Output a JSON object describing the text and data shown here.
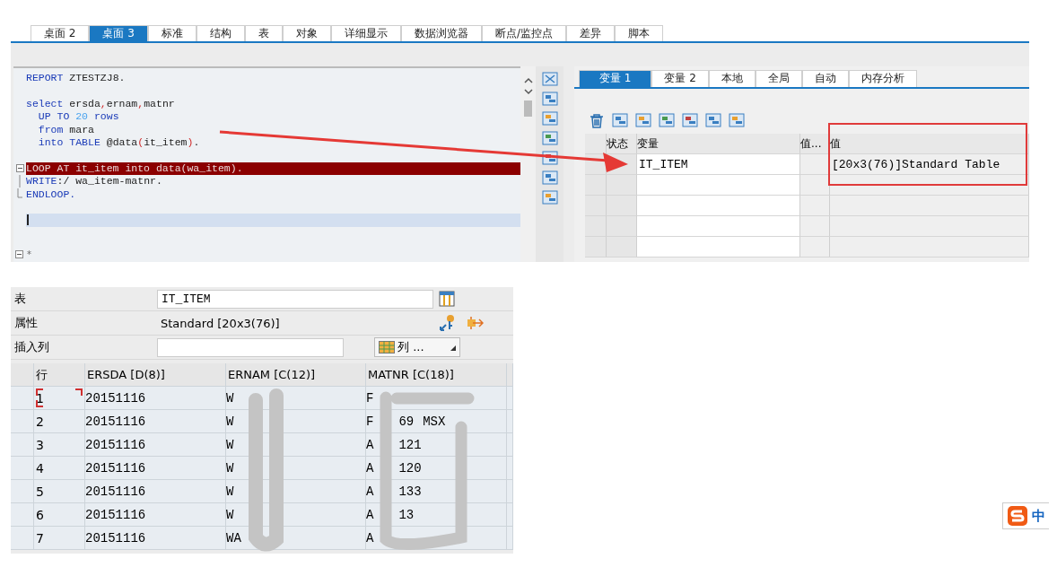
{
  "top_tabs": [
    {
      "label": "桌面 2",
      "selected": false
    },
    {
      "label": "桌面 3",
      "selected": true
    },
    {
      "label": "标准",
      "selected": false
    },
    {
      "label": "结构",
      "selected": false
    },
    {
      "label": "表",
      "selected": false
    },
    {
      "label": "对象",
      "selected": false
    },
    {
      "label": "详细显示",
      "selected": false
    },
    {
      "label": "数据浏览器",
      "selected": false
    },
    {
      "label": "断点/监控点",
      "selected": false
    },
    {
      "label": "差异",
      "selected": false
    },
    {
      "label": "脚本",
      "selected": false
    }
  ],
  "editor": {
    "lines": [
      {
        "kind": "code",
        "current": false,
        "cursor": false,
        "tokens": [
          {
            "t": "REPORT",
            "kind": "kw"
          },
          {
            "t": " ZTESTZJ8.",
            "kind": "plain"
          }
        ]
      },
      {
        "kind": "blank",
        "current": false,
        "cursor": false
      },
      {
        "kind": "code",
        "current": false,
        "cursor": false,
        "tokens": [
          {
            "t": "select",
            "kind": "kw"
          },
          {
            "t": " ersda",
            "kind": "plain"
          },
          {
            "t": ",",
            "kind": "punct"
          },
          {
            "t": "ernam",
            "kind": "plain"
          },
          {
            "t": ",",
            "kind": "punct"
          },
          {
            "t": "matnr",
            "kind": "plain"
          }
        ]
      },
      {
        "kind": "code",
        "current": false,
        "cursor": false,
        "tokens": [
          {
            "t": "  UP TO ",
            "kind": "kw"
          },
          {
            "t": "20",
            "kind": "num"
          },
          {
            "t": " rows",
            "kind": "kw"
          }
        ]
      },
      {
        "kind": "code",
        "current": false,
        "cursor": false,
        "tokens": [
          {
            "t": "  from",
            "kind": "kw"
          },
          {
            "t": " mara",
            "kind": "plain"
          }
        ]
      },
      {
        "kind": "code",
        "current": false,
        "cursor": false,
        "tokens": [
          {
            "t": "  into TABLE",
            "kind": "kw"
          },
          {
            "t": " @data",
            "kind": "plain"
          },
          {
            "t": "(",
            "kind": "punct"
          },
          {
            "t": "it_item",
            "kind": "plain"
          },
          {
            "t": ")",
            "kind": "punct"
          },
          {
            "t": ".",
            "kind": "plain"
          }
        ]
      },
      {
        "kind": "blank",
        "current": false,
        "cursor": false
      },
      {
        "kind": "fold_start",
        "current": true,
        "cursor": false,
        "tokens": [
          {
            "t": "LOOP AT it_item into data(wa_item).",
            "kind": "plain"
          }
        ]
      },
      {
        "kind": "fold_inner",
        "current": false,
        "cursor": false,
        "tokens": [
          {
            "t": "WRITE",
            "kind": "kw"
          },
          {
            "t": ":/ wa_item-matnr.",
            "kind": "plain"
          }
        ]
      },
      {
        "kind": "fold_end",
        "current": false,
        "cursor": false,
        "tokens": [
          {
            "t": "ENDLOOP.",
            "kind": "kw"
          }
        ]
      },
      {
        "kind": "blank",
        "current": false,
        "cursor": false
      },
      {
        "kind": "blank",
        "current": false,
        "cursor": true
      }
    ],
    "footer_mark": "*"
  },
  "var_tabs": [
    {
      "label": "变量 1",
      "selected": true
    },
    {
      "label": "变量 2",
      "selected": false
    },
    {
      "label": "本地",
      "selected": false
    },
    {
      "label": "全局",
      "selected": false
    },
    {
      "label": "自动",
      "selected": false
    },
    {
      "label": "内存分析",
      "selected": false
    }
  ],
  "var_table": {
    "columns": [
      "状态",
      "变量",
      "值...",
      "值"
    ],
    "rows": [
      {
        "variable": "IT_ITEM",
        "value": "[20x3(76)]Standard Table"
      }
    ]
  },
  "table_view": {
    "table_label": "表",
    "table_name": "IT_ITEM",
    "attr_label": "属性",
    "attr_value": "Standard [20x3(76)]",
    "insert_label": "插入列",
    "columns_button": "列 ...",
    "columns": [
      "行",
      "ERSDA [D(8)]",
      "ERNAM [C(12)]",
      "MATNR [C(18)]"
    ],
    "rows": [
      {
        "row": "1",
        "focused": true,
        "ersda": "20151116",
        "ernam": [
          "W"
        ],
        "matnr": [
          "F"
        ]
      },
      {
        "row": "2",
        "focused": false,
        "ersda": "20151116",
        "ernam": [
          "W"
        ],
        "matnr": [
          "F",
          "69",
          "MSX"
        ]
      },
      {
        "row": "3",
        "focused": false,
        "ersda": "20151116",
        "ernam": [
          "W"
        ],
        "matnr": [
          "A",
          "121"
        ]
      },
      {
        "row": "4",
        "focused": false,
        "ersda": "20151116",
        "ernam": [
          "W"
        ],
        "matnr": [
          "A",
          "120"
        ]
      },
      {
        "row": "5",
        "focused": false,
        "ersda": "20151116",
        "ernam": [
          "W"
        ],
        "matnr": [
          "A",
          "133"
        ]
      },
      {
        "row": "6",
        "focused": false,
        "ersda": "20151116",
        "ernam": [
          "W"
        ],
        "matnr": [
          "A",
          "13"
        ]
      },
      {
        "row": "7",
        "focused": false,
        "ersda": "20151116",
        "ernam": [
          "WA"
        ],
        "matnr": [
          "A"
        ]
      }
    ]
  },
  "ime": {
    "label": "中"
  }
}
